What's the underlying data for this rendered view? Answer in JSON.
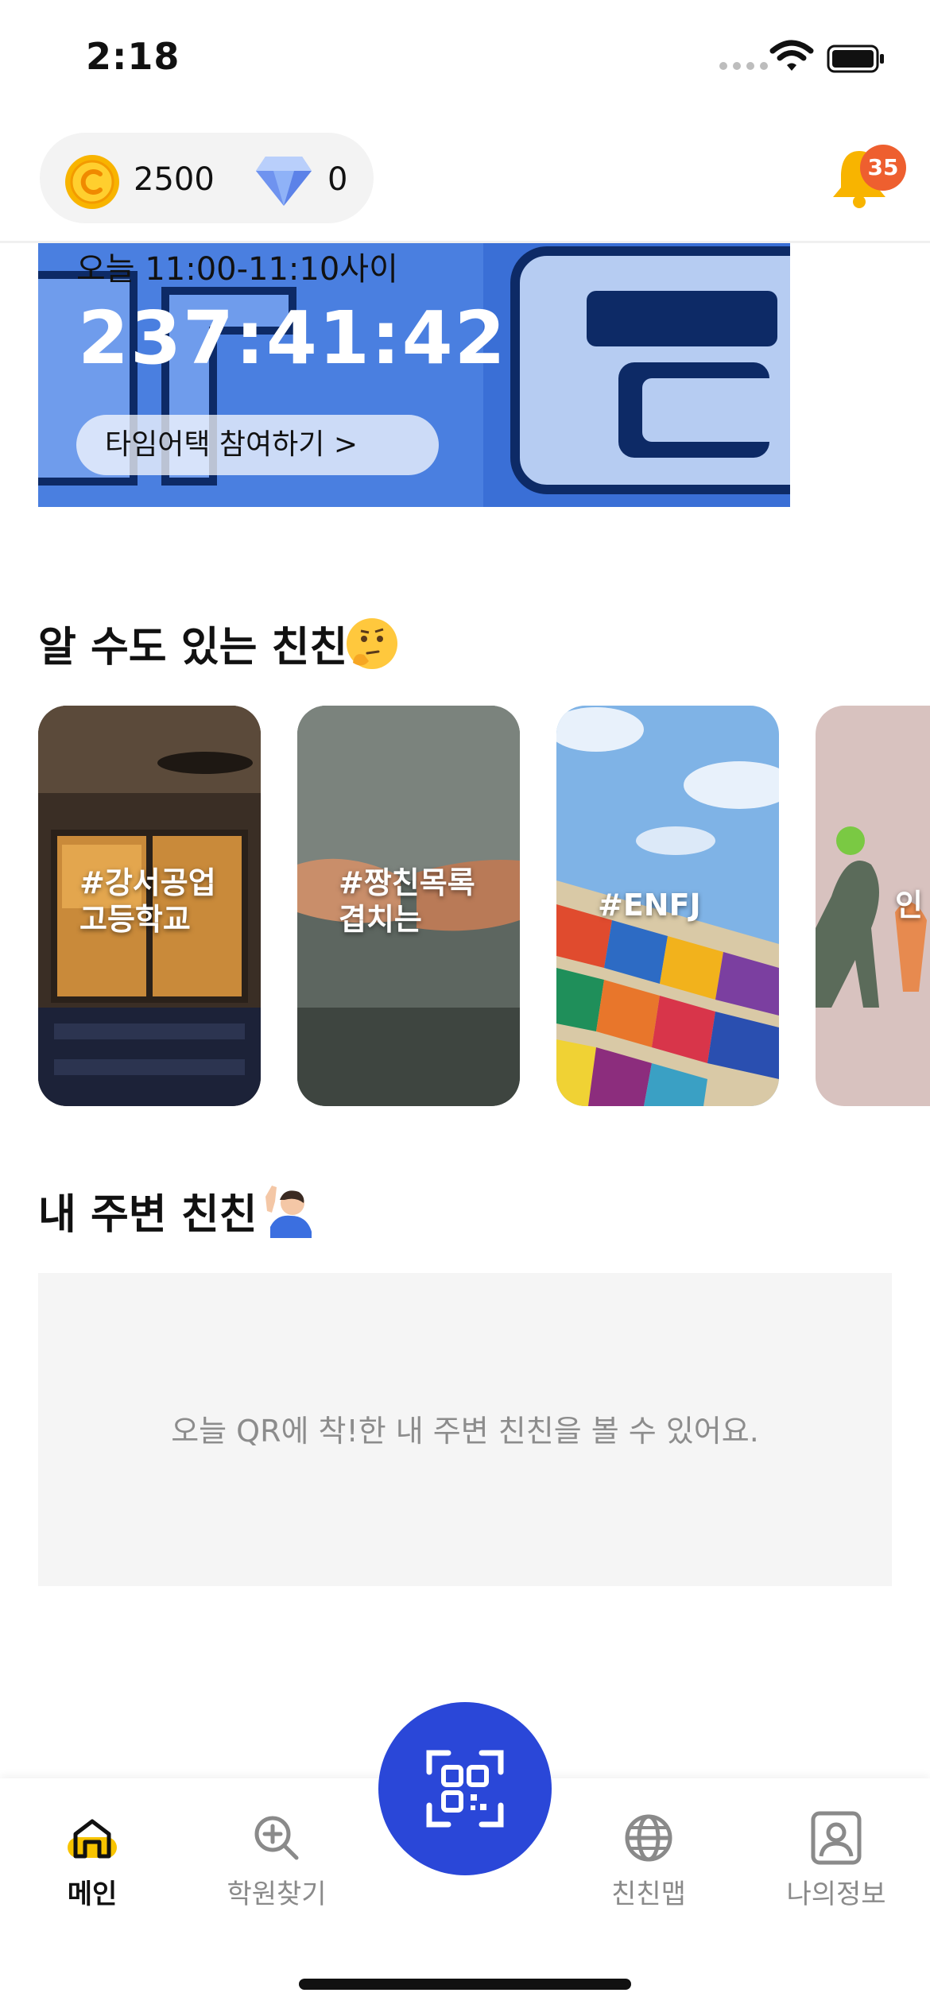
{
  "status_bar": {
    "time": "2:18"
  },
  "header": {
    "coin_value": "2500",
    "gem_value": "0",
    "notification_count": "35",
    "colors": {
      "coin": "#f8b400",
      "gem": "#7aa0f5",
      "badge": "#ee5f2f",
      "bell": "#f8b400"
    }
  },
  "banner": {
    "subtitle": "오늘 11:00-11:10사이",
    "timer": "237:41:42",
    "join_label": "타임어택 참여하기 >",
    "colors": {
      "background": "#3a6fd6"
    }
  },
  "suggested": {
    "title": "알 수도 있는 친친",
    "emoji": "thinking-face-emoji",
    "cards": [
      {
        "label": "#강서공업\n고등학교"
      },
      {
        "label": "#짱친목록\n겹치는"
      },
      {
        "label": "#ENFJ"
      },
      {
        "label": "인"
      }
    ]
  },
  "nearby": {
    "title": "내 주변 친친",
    "emoji": "waving-person-emoji",
    "empty_text": "오늘 QR에 착!한 내 주변 친친을 볼 수 있어요."
  },
  "tab_bar": {
    "tabs": [
      {
        "label": "메인",
        "icon": "home-icon",
        "active": true
      },
      {
        "label": "학원찾기",
        "icon": "search-plus-icon",
        "active": false
      },
      {
        "label": "친친맵",
        "icon": "globe-icon",
        "active": false
      },
      {
        "label": "나의정보",
        "icon": "profile-icon",
        "active": false
      }
    ],
    "center_button_icon": "qr-scan-icon",
    "colors": {
      "accent": "#2a47d8",
      "home_highlight": "#f8c400"
    }
  }
}
